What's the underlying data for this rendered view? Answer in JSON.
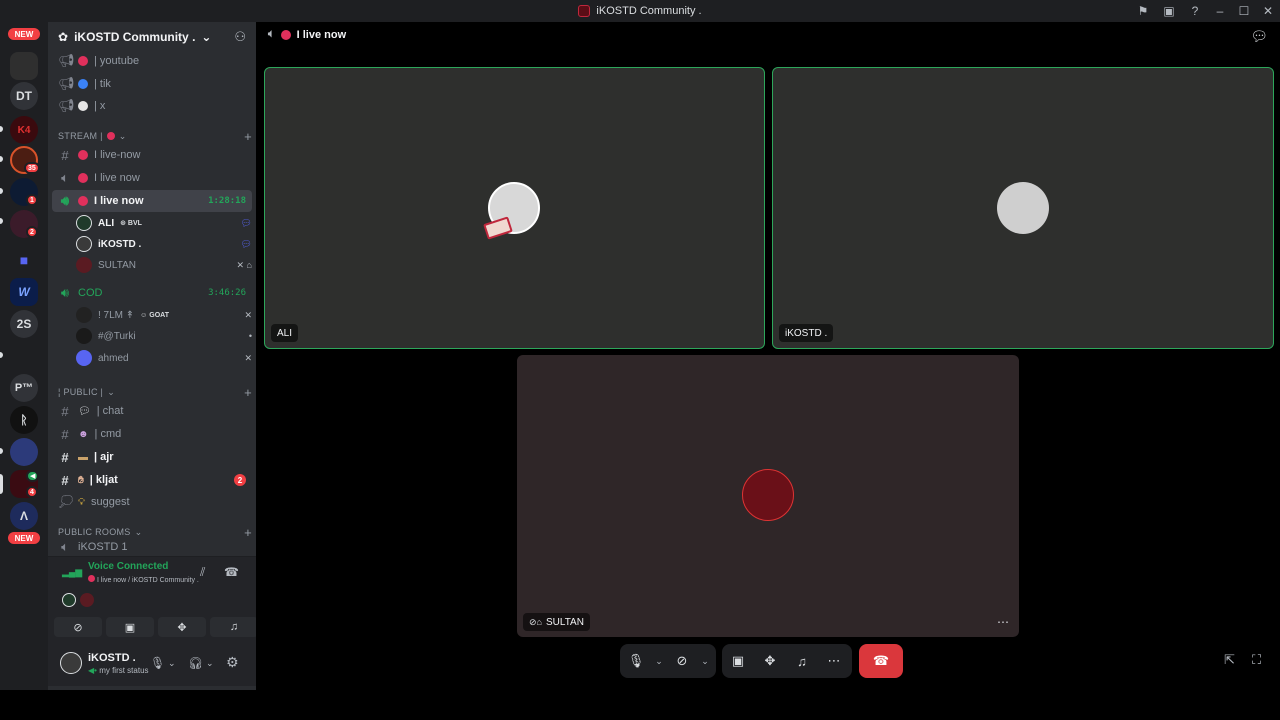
{
  "window": {
    "title": "iKOSTD Community ."
  },
  "rail": {
    "badge_new_top": "NEW",
    "badge_new_bottom": "NEW",
    "servers": [
      {
        "label": "",
        "icon": "server-avatar"
      },
      {
        "label": "DT",
        "icon": "server-text"
      },
      {
        "label": "",
        "icon": "server-avatar"
      },
      {
        "label": "",
        "icon": "server-avatar",
        "badge": "35"
      },
      {
        "label": "",
        "icon": "server-avatar",
        "badge": "1"
      },
      {
        "label": "",
        "icon": "server-avatar",
        "badge": "2"
      },
      {
        "label": "",
        "icon": "folder-icon"
      },
      {
        "label": "",
        "icon": "server-avatar"
      },
      {
        "label": "2S",
        "icon": "server-text"
      },
      {
        "label": "P™",
        "icon": "server-text"
      },
      {
        "label": "",
        "icon": "server-avatar"
      },
      {
        "label": "",
        "icon": "server-avatar"
      },
      {
        "label": "",
        "icon": "server-avatar",
        "badge": "4"
      },
      {
        "label": "",
        "icon": "server-avatar"
      }
    ]
  },
  "sidebar": {
    "guild_name": "iKOSTD Community .",
    "channels_top": [
      {
        "name": "| youtube",
        "dot": "#e0305c"
      },
      {
        "name": "| tik",
        "dot": "#3b82f6"
      },
      {
        "name": "| x",
        "dot": "#e6e6e6"
      }
    ],
    "category_stream": "STREAM |",
    "stream_channels": [
      {
        "name": "I live-now",
        "icon": "hash-icon"
      },
      {
        "name": "I live now",
        "icon": "speaker-icon"
      },
      {
        "name": "I live now",
        "icon": "speaker-live-icon",
        "time": "1:28:18",
        "active": true
      }
    ],
    "live_users": [
      {
        "name": "ALI",
        "tag": "BVL",
        "highlight": true
      },
      {
        "name": "iKOSTD .",
        "highlight": true
      },
      {
        "name": "SULTAN",
        "highlight": false
      }
    ],
    "cod": {
      "name": "COD",
      "time": "3:46:26"
    },
    "cod_users": [
      {
        "name": "! 7LM ↟",
        "tag": "GOAT"
      },
      {
        "name": "#@Turki"
      },
      {
        "name": "ahmed"
      }
    ],
    "category_public": "¦ PUBLIC |",
    "public_channels": [
      {
        "name": "| chat"
      },
      {
        "name": "| cmd"
      },
      {
        "name": "| ajr",
        "bright": true
      },
      {
        "name": "| kljat",
        "bright": true,
        "badge": "2"
      },
      {
        "name": "suggest"
      }
    ],
    "category_rooms": "PUBLIC ROOMS",
    "rooms_peek": "iKOSTD 1"
  },
  "voice": {
    "status": "Voice Connected",
    "sub": "I live now / iKOSTD Community ."
  },
  "user": {
    "name": "iKOSTD .",
    "status": "my first status"
  },
  "stage": {
    "channel": "I live now",
    "tiles": [
      {
        "name": "ALI"
      },
      {
        "name": "iKOSTD ."
      },
      {
        "name": "SULTAN"
      }
    ]
  },
  "colors": {
    "accent_green": "#23a55a",
    "danger_red": "#da373c",
    "tile_bg": "#2e2f2d",
    "tile_bg_sultan": "#2f2628"
  }
}
